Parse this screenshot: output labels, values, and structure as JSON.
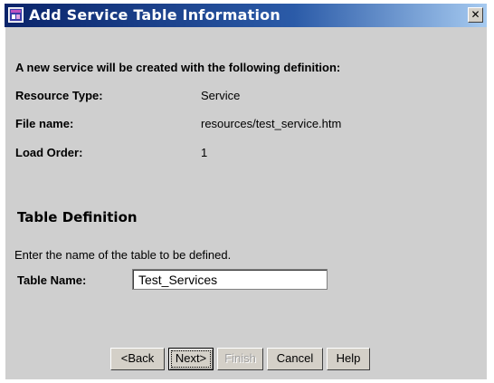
{
  "window": {
    "title": "Add Service Table Information",
    "close_symbol": "✕"
  },
  "info": {
    "intro": "A new service will be created with the following definition:",
    "resource_type_label": "Resource Type:",
    "resource_type_value": "Service",
    "file_name_label": "File name:",
    "file_name_value": "resources/test_service.htm",
    "load_order_label": "Load Order:",
    "load_order_value": "1"
  },
  "table_definition": {
    "heading": "Table Definition",
    "instruction": "Enter the name of the table to be defined.",
    "table_name_label": "Table Name:",
    "table_name_value": "Test_Services"
  },
  "buttons": {
    "back": "<Back",
    "next": "Next>",
    "finish": "Finish",
    "cancel": "Cancel",
    "help": "Help"
  },
  "icons": {
    "app_icon": "app-window-icon",
    "close": "close-icon"
  }
}
